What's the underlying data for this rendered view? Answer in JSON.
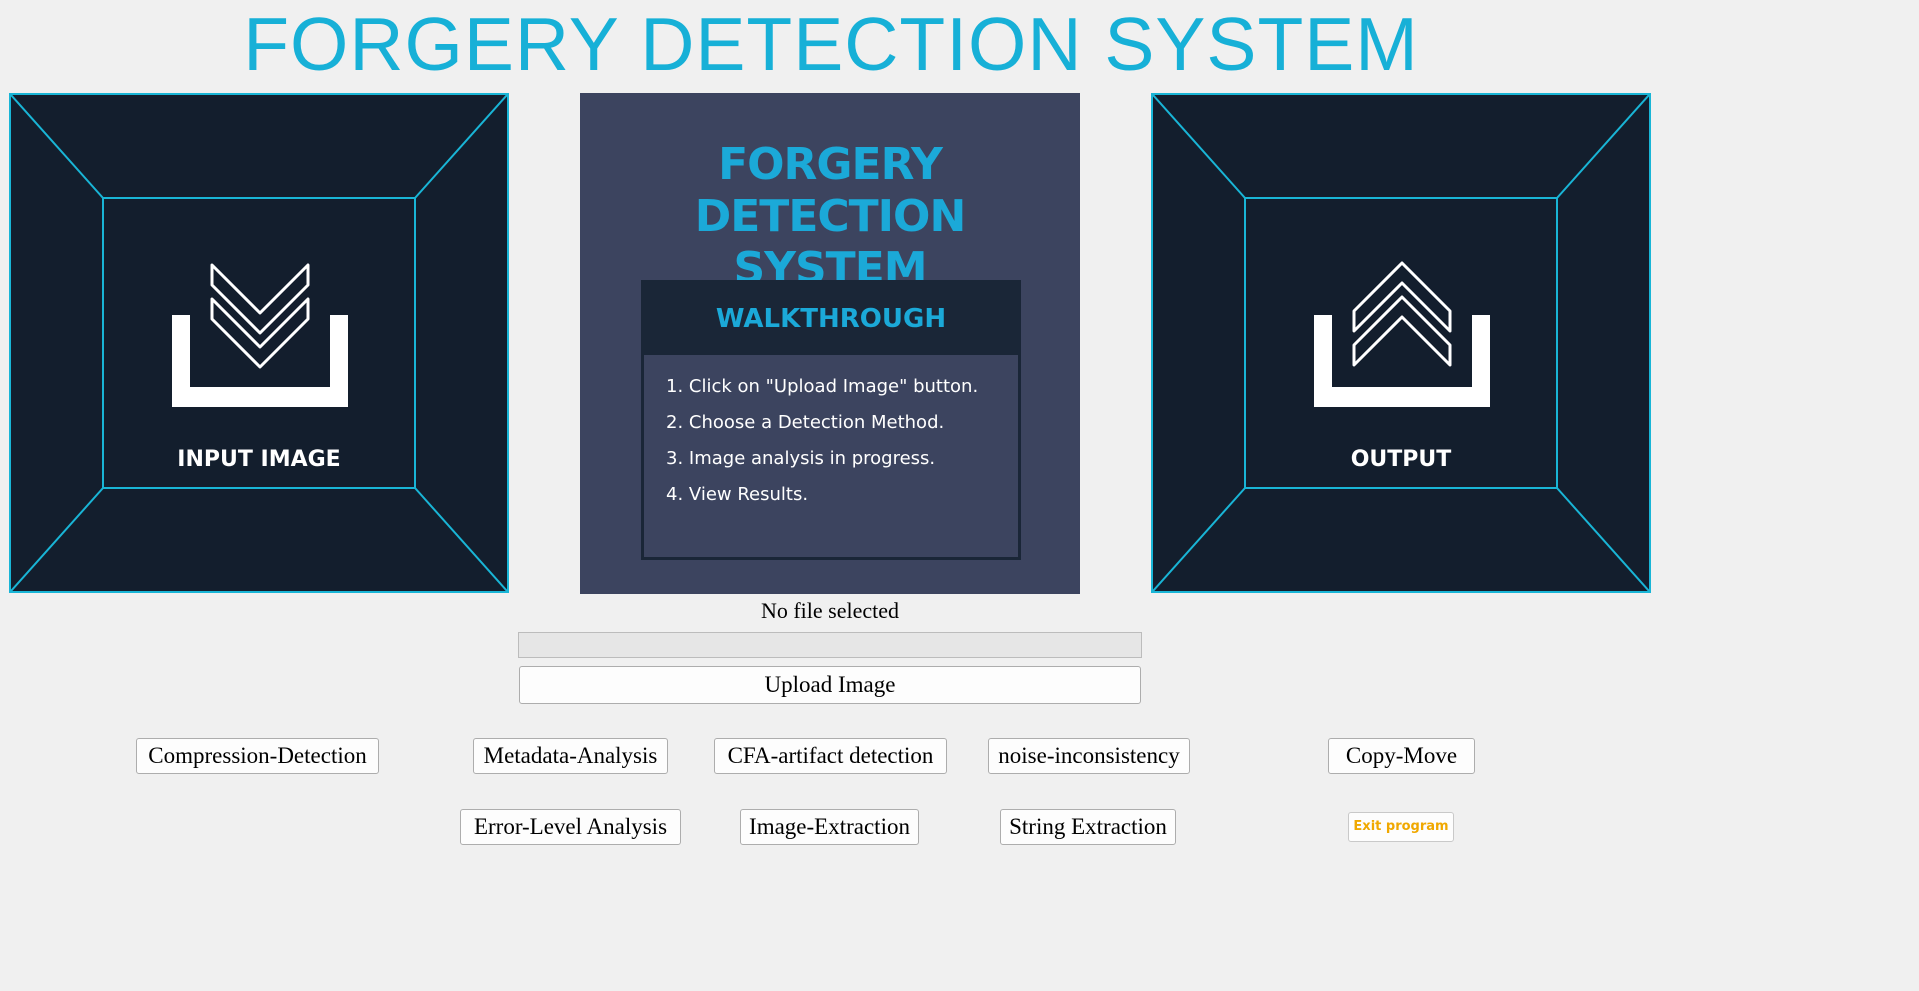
{
  "app": {
    "title": "FORGERY DETECTION SYSTEM"
  },
  "input_panel": {
    "label": "INPUT IMAGE",
    "icon": "download-tray-icon"
  },
  "output_panel": {
    "label": "OUTPUT",
    "icon": "upload-tray-icon"
  },
  "walkthrough": {
    "title_line1": "FORGERY DETECTION",
    "title_line2": "SYSTEM",
    "heading": "WALKTHROUGH",
    "steps": [
      "1. Click on \"Upload Image\" button.",
      "2. Choose a Detection Method.",
      "3. Image analysis in progress.",
      "4. View Results."
    ]
  },
  "file": {
    "status": "No file selected",
    "progress": 0
  },
  "buttons": {
    "upload": "Upload Image",
    "compression": "Compression-Detection",
    "metadata": "Metadata-Analysis",
    "cfa": "CFA-artifact detection",
    "noise": "noise-inconsistency",
    "copy_move": "Copy-Move",
    "ela": "Error-Level Analysis",
    "image_extraction": "Image-Extraction",
    "string_extraction": "String Extraction",
    "exit": "Exit program"
  },
  "colors": {
    "accent": "#17b0d7",
    "panel_bg": "#131e2d",
    "walkthrough_bg": "#3c445f",
    "exit_text": "#f0a800"
  }
}
